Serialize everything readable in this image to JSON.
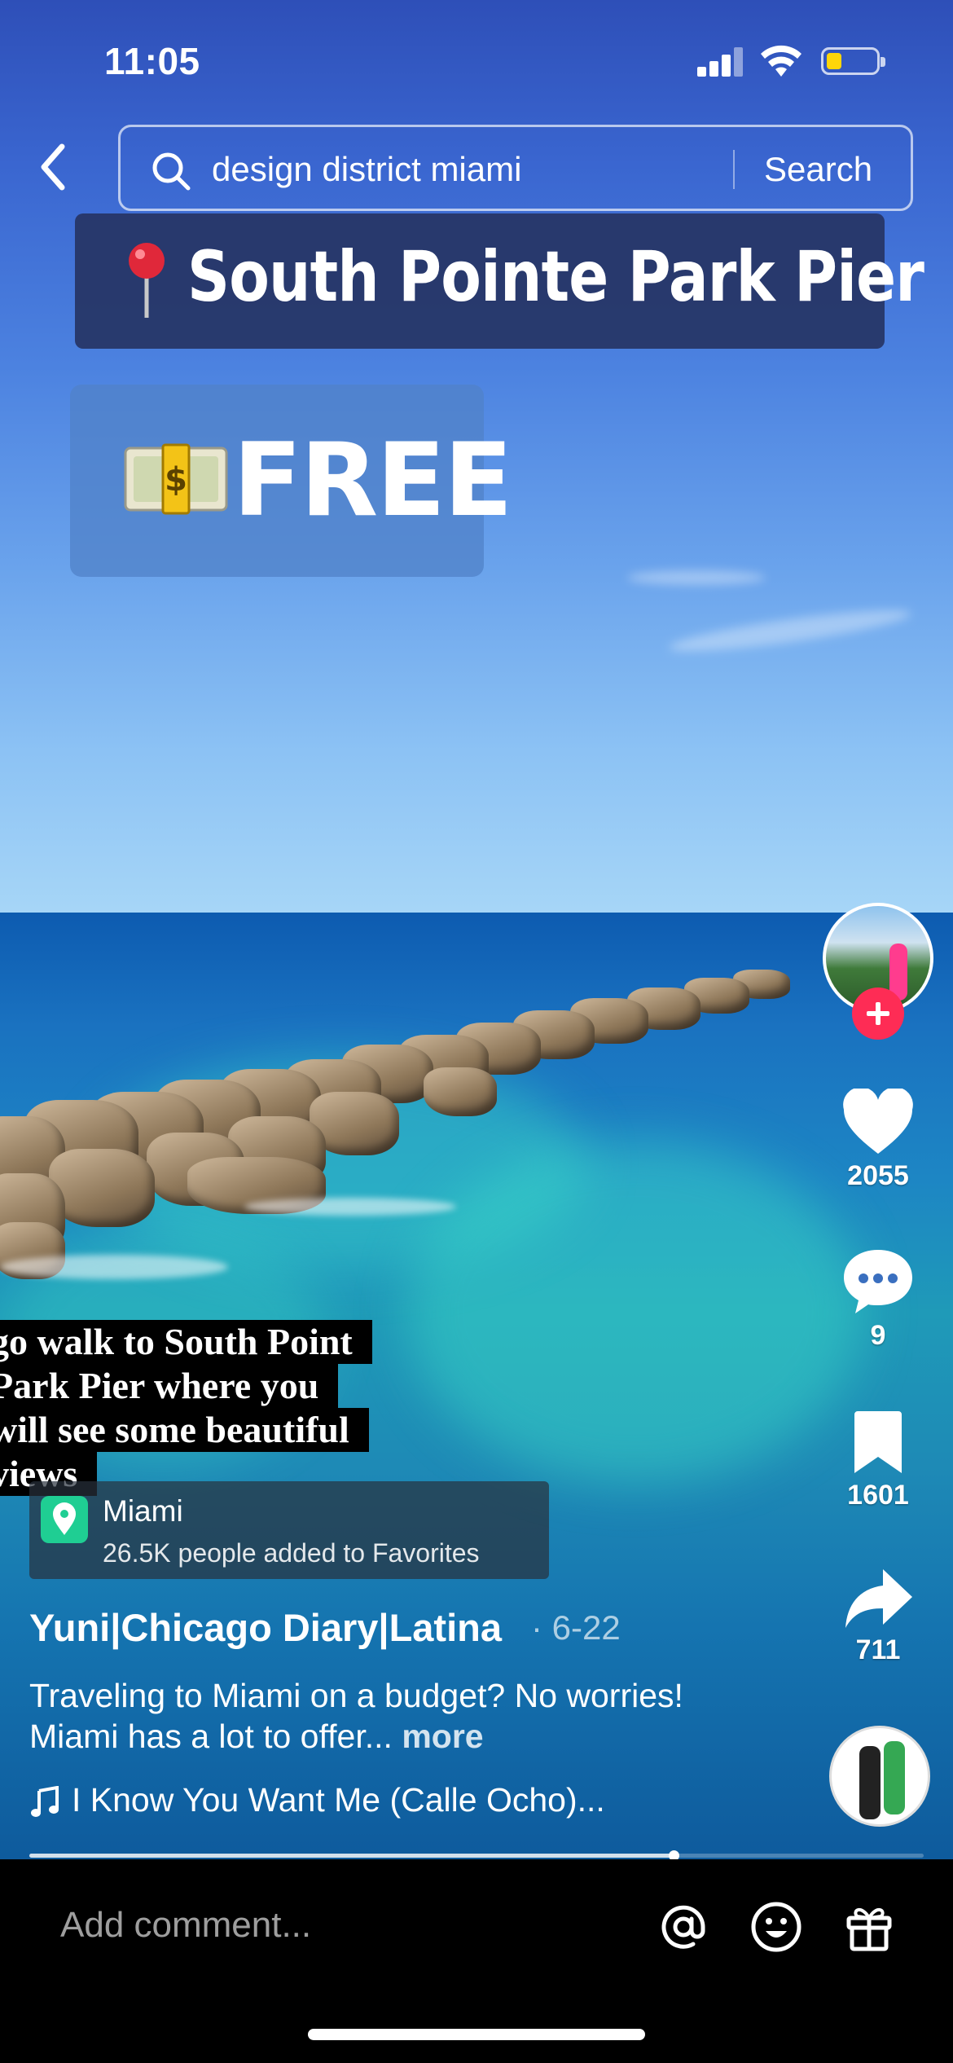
{
  "status_bar": {
    "time": "11:05"
  },
  "search": {
    "query": "design district miami",
    "button_label": "Search"
  },
  "stickers": {
    "title": "South Pointe Park Pier",
    "price": "FREE",
    "caption_lines": [
      "go walk to South Point",
      "Park Pier where you",
      "will see some beautiful",
      "views"
    ]
  },
  "location": {
    "name": "Miami",
    "favorites": "26.5K people added to Favorites"
  },
  "post": {
    "author": "Yuni|Chicago Diary|Latina",
    "date": "· 6-22",
    "description": "Traveling to Miami on a budget? No worries! Miami has a lot to offer...",
    "more_label": "more",
    "music": "I Know You Want Me (Calle Ocho)..."
  },
  "actions": {
    "likes": "2055",
    "comments": "9",
    "saves": "1601",
    "shares": "711"
  },
  "progress": {
    "fraction": 0.72
  },
  "comment_bar": {
    "placeholder": "Add comment..."
  },
  "colors": {
    "follow": "#fe2c55",
    "location_badge": "#1fce93",
    "battery": "#ffd60a"
  }
}
